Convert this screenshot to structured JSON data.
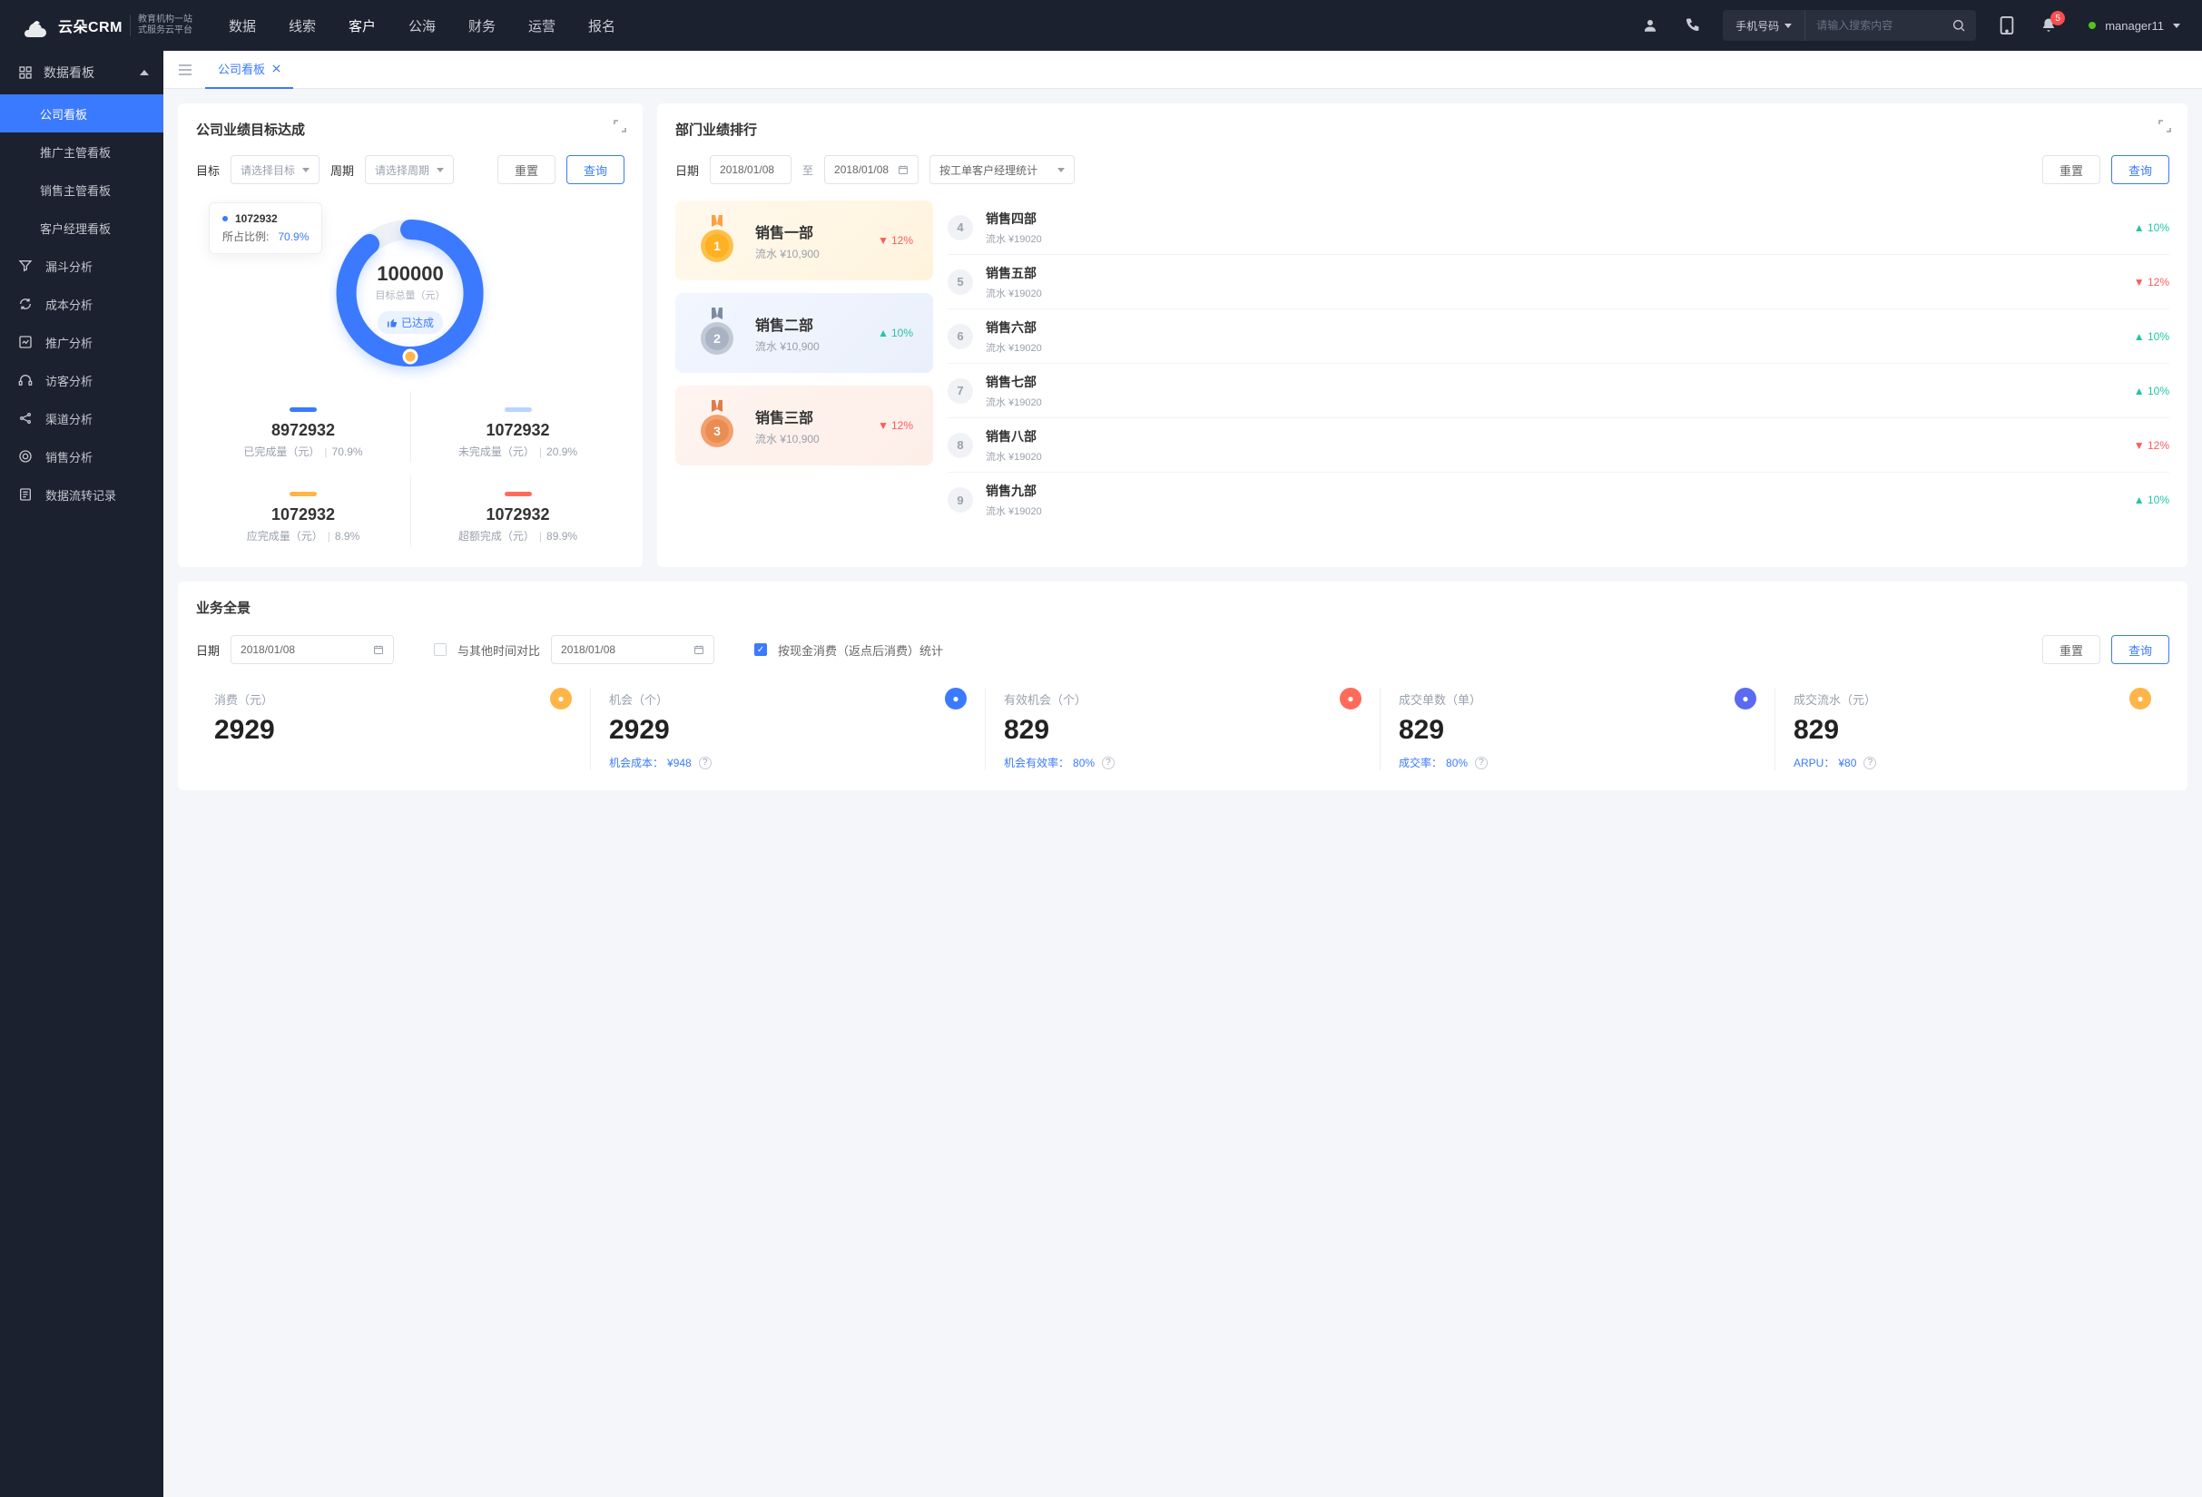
{
  "topbar": {
    "brand": "云朵CRM",
    "brand_sub1": "教育机构一站",
    "brand_sub2": "式服务云平台",
    "nav": [
      "数据",
      "线索",
      "客户",
      "公海",
      "财务",
      "运营",
      "报名"
    ],
    "nav_active_index": 2,
    "search_cat": "手机号码",
    "search_placeholder": "请输入搜索内容",
    "notif_count": "5",
    "user_name": "manager11"
  },
  "sidebar": {
    "section": "数据看板",
    "children": [
      "公司看板",
      "推广主管看板",
      "销售主管看板",
      "客户经理看板"
    ],
    "children_active_index": 0,
    "roots": [
      "漏斗分析",
      "成本分析",
      "推广分析",
      "访客分析",
      "渠道分析",
      "销售分析",
      "数据流转记录"
    ]
  },
  "tab": {
    "label": "公司看板"
  },
  "target_card": {
    "title": "公司业绩目标达成",
    "filter_target": "目标",
    "filter_target_ph": "请选择目标",
    "filter_period": "周期",
    "filter_period_ph": "请选择周期",
    "reset": "重置",
    "query": "查询",
    "tooltip_value": "1072932",
    "tooltip_ratio_label": "所占比例:",
    "tooltip_ratio": "70.9%",
    "center_value": "100000",
    "center_label": "目标总量（元）",
    "center_badge": "已达成",
    "metrics": [
      {
        "bar": "#3a7afe",
        "value": "8972932",
        "label": "已完成量（元）",
        "pct": "70.9%"
      },
      {
        "bar": "#b9d4ff",
        "value": "1072932",
        "label": "未完成量（元）",
        "pct": "20.9%"
      },
      {
        "bar": "#ffb547",
        "value": "1072932",
        "label": "应完成量（元）",
        "pct": "8.9%"
      },
      {
        "bar": "#ff6b5b",
        "value": "1072932",
        "label": "超额完成（元）",
        "pct": "89.9%"
      }
    ]
  },
  "rank_card": {
    "title": "部门业绩排行",
    "date_label": "日期",
    "date_from": "2018/01/08",
    "date_to_label": "至",
    "date_to": "2018/01/08",
    "group_by": "按工单客户经理统计",
    "reset": "重置",
    "query": "查询",
    "podium": [
      {
        "name": "销售一部",
        "flow": "流水 ¥10,900",
        "delta": "12%",
        "dir": "down"
      },
      {
        "name": "销售二部",
        "flow": "流水 ¥10,900",
        "delta": "10%",
        "dir": "up"
      },
      {
        "name": "销售三部",
        "flow": "流水 ¥10,900",
        "delta": "12%",
        "dir": "down"
      }
    ],
    "list": [
      {
        "n": "4",
        "name": "销售四部",
        "flow": "流水 ¥19020",
        "delta": "10%",
        "dir": "up"
      },
      {
        "n": "5",
        "name": "销售五部",
        "flow": "流水 ¥19020",
        "delta": "12%",
        "dir": "down"
      },
      {
        "n": "6",
        "name": "销售六部",
        "flow": "流水 ¥19020",
        "delta": "10%",
        "dir": "up"
      },
      {
        "n": "7",
        "name": "销售七部",
        "flow": "流水 ¥19020",
        "delta": "10%",
        "dir": "up"
      },
      {
        "n": "8",
        "name": "销售八部",
        "flow": "流水 ¥19020",
        "delta": "12%",
        "dir": "down"
      },
      {
        "n": "9",
        "name": "销售九部",
        "flow": "流水 ¥19020",
        "delta": "10%",
        "dir": "up"
      }
    ]
  },
  "overview": {
    "title": "业务全景",
    "date_label": "日期",
    "date": "2018/01/08",
    "compare_label": "与其他时间对比",
    "compare_date": "2018/01/08",
    "chk_label": "按现金消费（返点后消费）统计",
    "reset": "重置",
    "query": "查询",
    "kpis": [
      {
        "label": "消费（元）",
        "icon": "#ffb547",
        "value": "2929",
        "foot_label": "",
        "foot_val": ""
      },
      {
        "label": "机会（个）",
        "icon": "#3a7afe",
        "value": "2929",
        "foot_label": "机会成本：",
        "foot_val": "¥948"
      },
      {
        "label": "有效机会（个）",
        "icon": "#ff6b5b",
        "value": "829",
        "foot_label": "机会有效率：",
        "foot_val": "80%"
      },
      {
        "label": "成交单数（单）",
        "icon": "#5b6af0",
        "value": "829",
        "foot_label": "成交率：",
        "foot_val": "80%"
      },
      {
        "label": "成交流水（元）",
        "icon": "#ffb547",
        "value": "829",
        "foot_label": "ARPU：",
        "foot_val": "¥80"
      }
    ]
  },
  "chart_data": {
    "type": "pie",
    "title": "目标总量（元）",
    "total": 100000,
    "series": [
      {
        "name": "已完成量（元）",
        "value": 8972932,
        "pct": 70.9,
        "color": "#3a7afe"
      },
      {
        "name": "未完成量（元）",
        "value": 1072932,
        "pct": 20.9,
        "color": "#b9d4ff"
      },
      {
        "name": "应完成量（元）",
        "value": 1072932,
        "pct": 8.9,
        "color": "#ffb547"
      },
      {
        "name": "超额完成（元）",
        "value": 1072932,
        "pct": 89.9,
        "color": "#ff6b5b"
      }
    ]
  }
}
